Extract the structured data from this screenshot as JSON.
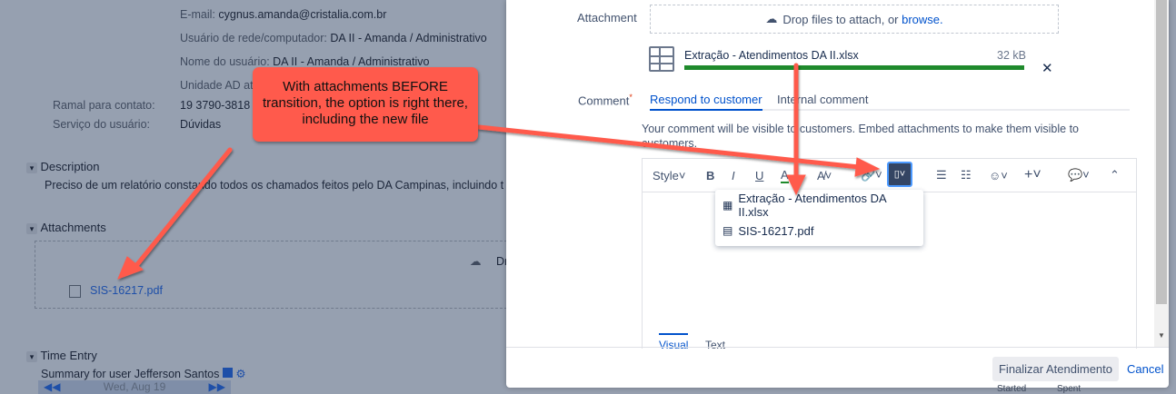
{
  "issue": {
    "fields": [
      {
        "label": "E-mail:",
        "value": "cygnus.amanda@cristalia.com.br"
      },
      {
        "label": "Usuário de rede/computador:",
        "value": "DA II - Amanda / Administrativo"
      },
      {
        "label": "Nome do usuário:",
        "value": "DA II - Amanda / Administrativo"
      },
      {
        "label": "Unidade AD at",
        "value": ""
      }
    ],
    "ramal_label": "Ramal para contato:",
    "ramal_value": "19 3790-3818",
    "servico_label": "Serviço do usuário:",
    "servico_value": "Dúvidas",
    "description_title": "Description",
    "description_text": "Preciso de um relatório constando todos os chamados feitos pelo DA Campinas, incluindo t",
    "attachments_title": "Attachments",
    "attachments_drop": "Dr",
    "attachment_file": "SIS-16217.pdf",
    "time_entry_title": "Time Entry",
    "time_entry_summary": "Summary for user Jefferson Santos",
    "date": "Wed, Aug 19",
    "col_started": "Started",
    "col_spent": "Spent"
  },
  "modal": {
    "attachment_label": "Attachment",
    "drop_text": "Drop files to attach, or ",
    "browse": "browse.",
    "upload_file": "Extração - Atendimentos DA II.xlsx",
    "upload_size": "32 kB",
    "upload_progress": 1.0,
    "comment_label": "Comment",
    "required_mark": "*",
    "tabs": [
      "Respond to customer",
      "Internal comment"
    ],
    "visibility_note": "Your comment will be visible to customers. Embed attachments to make them visible to customers.",
    "toolbar": {
      "style": "Style",
      "bold": "B",
      "italic": "I",
      "underline": "U",
      "color": "A"
    },
    "attach_menu": [
      "Extração - Atendimentos DA II.xlsx",
      "SIS-16217.pdf"
    ],
    "editor_tabs": [
      "Visual",
      "Text"
    ],
    "submit": "Finalizar Atendimento",
    "cancel": "Cancel"
  },
  "annotation": {
    "callout": "With attachments BEFORE transition, the option is right there, including the new file"
  },
  "colors": {
    "accent": "#0052cc",
    "progress": "#1f8a2c",
    "callout": "#ff5a4c",
    "active_button": "#344563"
  }
}
